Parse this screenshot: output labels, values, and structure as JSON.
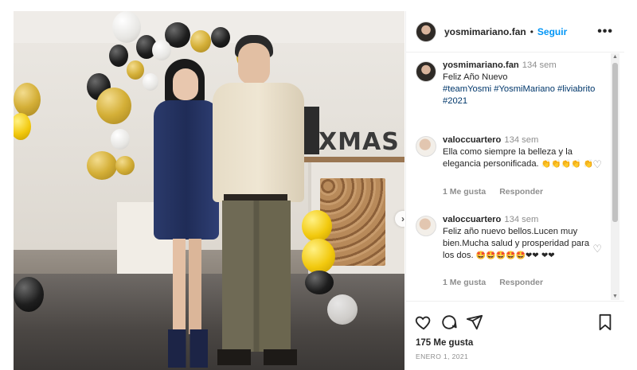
{
  "post": {
    "account": "yosmimariano.fan",
    "separator": "•",
    "follow_label": "Seguir",
    "more_label": "•••",
    "next_label": "›"
  },
  "photo": {
    "sign_text": "XMAS"
  },
  "caption": {
    "user": "yosmimariano.fan",
    "time": "134 sem",
    "text": "Feliz Año Nuevo",
    "tags": "#teamYosmi #YosmiMariano #liviabrito #2021"
  },
  "comments": [
    {
      "user": "valoccuartero",
      "time": "134 sem",
      "text": "Ella como siempre la belleza y la elegancia personificada.",
      "emojis": "👏👏👏👏 👏",
      "likes": "1 Me gusta",
      "reply": "Responder"
    },
    {
      "user": "valoccuartero",
      "time": "134 sem",
      "text": "Feliz año nuevo bellos.Lucen muy bien.Mucha salud y prosperidad para los dos.",
      "emojis": "🤩🤩🤩🤩🤩❤❤ ❤❤",
      "likes": "1 Me gusta",
      "reply": "Responder"
    }
  ],
  "footer": {
    "likes": "175 Me gusta",
    "date": "ENERO 1, 2021"
  },
  "icons": {
    "like": "heart-icon",
    "comment": "comment-icon",
    "share": "share-icon",
    "save": "bookmark-icon"
  },
  "colors": {
    "link": "#0095f6",
    "hashtag": "#00376b",
    "muted": "#8e8e8e"
  }
}
